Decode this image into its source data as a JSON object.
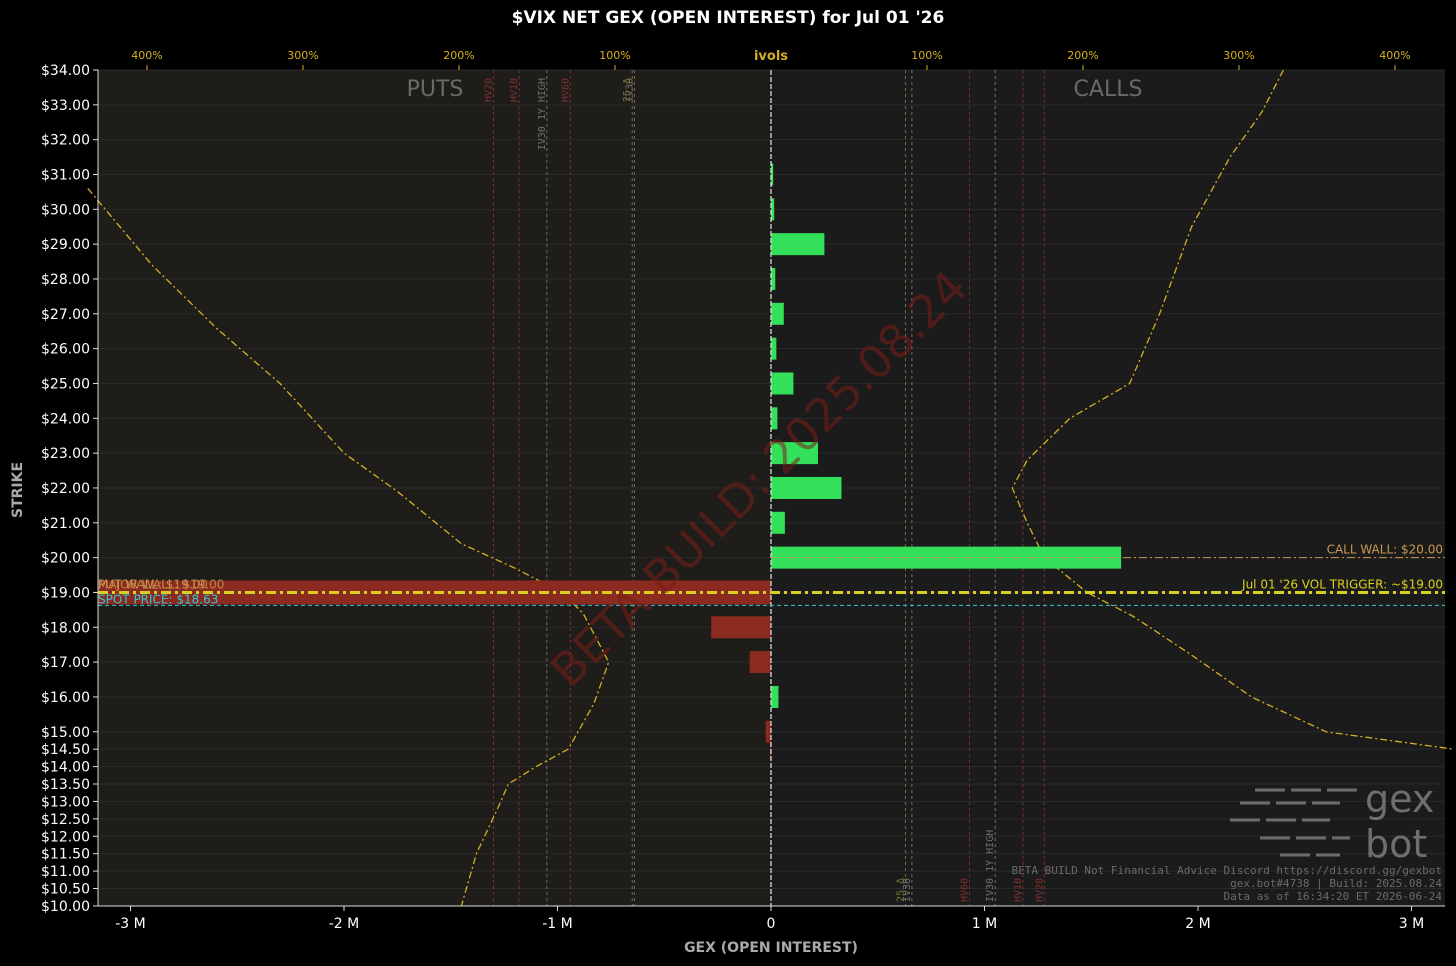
{
  "chart_data": {
    "type": "bar",
    "orientation": "horizontal",
    "title": "$VIX NET GEX (OPEN INTEREST) for Jul 01 '26",
    "xlabel": "GEX (OPEN INTEREST)",
    "ylabel": "STRIKE",
    "xlim": [
      -3.2,
      3.2
    ],
    "ylim": [
      10.0,
      34.0
    ],
    "x_unit": "M",
    "x_ticks": [
      {
        "value": -3,
        "label": "-3 M"
      },
      {
        "value": -2,
        "label": "-2 M"
      },
      {
        "value": -1,
        "label": "-1 M"
      },
      {
        "value": 0,
        "label": "0"
      },
      {
        "value": 1,
        "label": "1 M"
      },
      {
        "value": 2,
        "label": "2 M"
      },
      {
        "value": 3,
        "label": "3 M"
      }
    ],
    "y_ticks": [
      {
        "value": 34.0,
        "label": "$34.00"
      },
      {
        "value": 33.0,
        "label": "$33.00"
      },
      {
        "value": 32.0,
        "label": "$32.00"
      },
      {
        "value": 31.0,
        "label": "$31.00"
      },
      {
        "value": 30.0,
        "label": "$30.00"
      },
      {
        "value": 29.0,
        "label": "$29.00"
      },
      {
        "value": 28.0,
        "label": "$28.00"
      },
      {
        "value": 27.0,
        "label": "$27.00"
      },
      {
        "value": 26.0,
        "label": "$26.00"
      },
      {
        "value": 25.0,
        "label": "$25.00"
      },
      {
        "value": 24.0,
        "label": "$24.00"
      },
      {
        "value": 23.0,
        "label": "$23.00"
      },
      {
        "value": 22.0,
        "label": "$22.00"
      },
      {
        "value": 21.0,
        "label": "$21.00"
      },
      {
        "value": 20.0,
        "label": "$20.00"
      },
      {
        "value": 19.0,
        "label": "$19.00"
      },
      {
        "value": 18.0,
        "label": "$18.00"
      },
      {
        "value": 17.0,
        "label": "$17.00"
      },
      {
        "value": 16.0,
        "label": "$16.00"
      },
      {
        "value": 15.0,
        "label": "$15.00"
      },
      {
        "value": 14.5,
        "label": "$14.50"
      },
      {
        "value": 14.0,
        "label": "$14.00"
      },
      {
        "value": 13.5,
        "label": "$13.50"
      },
      {
        "value": 13.0,
        "label": "$13.00"
      },
      {
        "value": 12.5,
        "label": "$12.50"
      },
      {
        "value": 12.0,
        "label": "$12.00"
      },
      {
        "value": 11.5,
        "label": "$11.50"
      },
      {
        "value": 11.0,
        "label": "$11.00"
      },
      {
        "value": 10.5,
        "label": "$10.50"
      },
      {
        "value": 10.0,
        "label": "$10.00"
      }
    ],
    "top_axis": {
      "label": "ivols",
      "ticks": [
        {
          "value": -4,
          "label": "400%"
        },
        {
          "value": -3,
          "label": "300%"
        },
        {
          "value": -2,
          "label": "200%"
        },
        {
          "value": -1,
          "label": "100%"
        },
        {
          "value": 1,
          "label": "100%"
        },
        {
          "value": 2,
          "label": "200%"
        },
        {
          "value": 3,
          "label": "300%"
        },
        {
          "value": 4,
          "label": "400%"
        }
      ]
    },
    "bars": [
      {
        "strike": 31.0,
        "value": 0.01
      },
      {
        "strike": 30.0,
        "value": 0.015
      },
      {
        "strike": 29.0,
        "value": 0.25
      },
      {
        "strike": 28.0,
        "value": 0.02
      },
      {
        "strike": 27.0,
        "value": 0.06
      },
      {
        "strike": 26.0,
        "value": 0.025
      },
      {
        "strike": 25.0,
        "value": 0.105
      },
      {
        "strike": 24.0,
        "value": 0.03
      },
      {
        "strike": 23.0,
        "value": 0.22
      },
      {
        "strike": 22.0,
        "value": 0.33
      },
      {
        "strike": 21.0,
        "value": 0.065
      },
      {
        "strike": 20.0,
        "value": 1.64
      },
      {
        "strike": 19.0,
        "value": -3.2
      },
      {
        "strike": 18.0,
        "value": -0.28
      },
      {
        "strike": 17.0,
        "value": -0.1
      },
      {
        "strike": 16.0,
        "value": 0.035
      },
      {
        "strike": 15.0,
        "value": -0.025
      },
      {
        "strike": 14.5,
        "value": -0.005
      }
    ],
    "levels": [
      {
        "label": "CALL WALL: $20.00",
        "strike": 20.0,
        "color": "#c89a50",
        "side": "right"
      },
      {
        "label": "Jul 01 '26 VOL TRIGGER: ~$19.00",
        "strike": 19.0,
        "color": "#d8d020",
        "side": "right"
      },
      {
        "label": "MAJOR WALL: $19.00",
        "strike": 19.0,
        "color": "#c89a50",
        "side": "left"
      },
      {
        "label": "PUT WALL: $19.00",
        "strike": 19.0,
        "color": "#c89a50",
        "side": "left"
      },
      {
        "label": "SPOT PRICE: $18.63",
        "strike": 18.63,
        "color": "#30c8d8",
        "side": "left"
      }
    ],
    "vlines": [
      {
        "x": -1.3,
        "label": "HV20",
        "color": "#803030"
      },
      {
        "x": -1.18,
        "label": "HV10",
        "color": "#803030"
      },
      {
        "x": -1.05,
        "label": "IV30 1Y HIGH",
        "color": "#707070"
      },
      {
        "x": -0.94,
        "label": "HV60",
        "color": "#803030"
      },
      {
        "x": -0.64,
        "label": "IV30",
        "color": "#707070"
      },
      {
        "x": -0.65,
        "label": "25 Δ",
        "color": "#707030"
      },
      {
        "x": 0.63,
        "label": "25 Δ",
        "color": "#707030"
      },
      {
        "x": 0.66,
        "label": "IV30",
        "color": "#707070"
      },
      {
        "x": 0.93,
        "label": "HV60",
        "color": "#803030"
      },
      {
        "x": 1.05,
        "label": "IV30 1Y HIGH",
        "color": "#707070"
      },
      {
        "x": 1.18,
        "label": "HV10",
        "color": "#803030"
      },
      {
        "x": 1.28,
        "label": "HV20",
        "color": "#803030"
      }
    ],
    "iv_curve_left": [
      [
        -3.2,
        30.6
      ],
      [
        -2.9,
        28.4
      ],
      [
        -2.6,
        26.6
      ],
      [
        -2.3,
        25.0
      ],
      [
        -2.0,
        23.0
      ],
      [
        -1.75,
        21.9
      ],
      [
        -1.45,
        20.4
      ],
      [
        -1.2,
        19.7
      ],
      [
        -0.98,
        19.0
      ],
      [
        -0.88,
        18.4
      ],
      [
        -0.76,
        17.0
      ],
      [
        -0.83,
        15.8
      ],
      [
        -0.95,
        14.5
      ],
      [
        -1.1,
        14.0
      ],
      [
        -1.23,
        13.5
      ],
      [
        -1.28,
        12.8
      ],
      [
        -1.38,
        11.5
      ],
      [
        -1.45,
        10.0
      ]
    ],
    "iv_curve_right": [
      [
        2.4,
        34.0
      ],
      [
        2.3,
        32.8
      ],
      [
        2.15,
        31.5
      ],
      [
        1.97,
        29.5
      ],
      [
        1.82,
        27.0
      ],
      [
        1.68,
        25.0
      ],
      [
        1.4,
        24.0
      ],
      [
        1.2,
        22.8
      ],
      [
        1.13,
        22.0
      ],
      [
        1.2,
        21.0
      ],
      [
        1.28,
        20.0
      ],
      [
        1.48,
        19.0
      ],
      [
        1.7,
        18.3
      ],
      [
        1.97,
        17.2
      ],
      [
        2.25,
        16.0
      ],
      [
        2.6,
        15.0
      ],
      [
        3.2,
        14.5
      ]
    ],
    "annotations": {
      "puts_label": "PUTS",
      "calls_label": "CALLS",
      "watermark": "BETA BUILD: 2025.08.24",
      "footer": [
        "BETA BUILD Not Financial Advice Discord https://discord.gg/gexbot",
        "gex.bot#4738 | Build: 2025.08.24",
        "Data as of 16:34:20 ET 2026-06-24"
      ],
      "logo_top": "gex",
      "logo_bottom": "bot"
    },
    "colors": {
      "positive": "#33e05a",
      "negative": "#8b2a1e",
      "bg_left": "#1e1d1a",
      "bg_right": "#1b1b1b",
      "axis_text": "#ffffff",
      "gold": "#d4b020"
    }
  }
}
